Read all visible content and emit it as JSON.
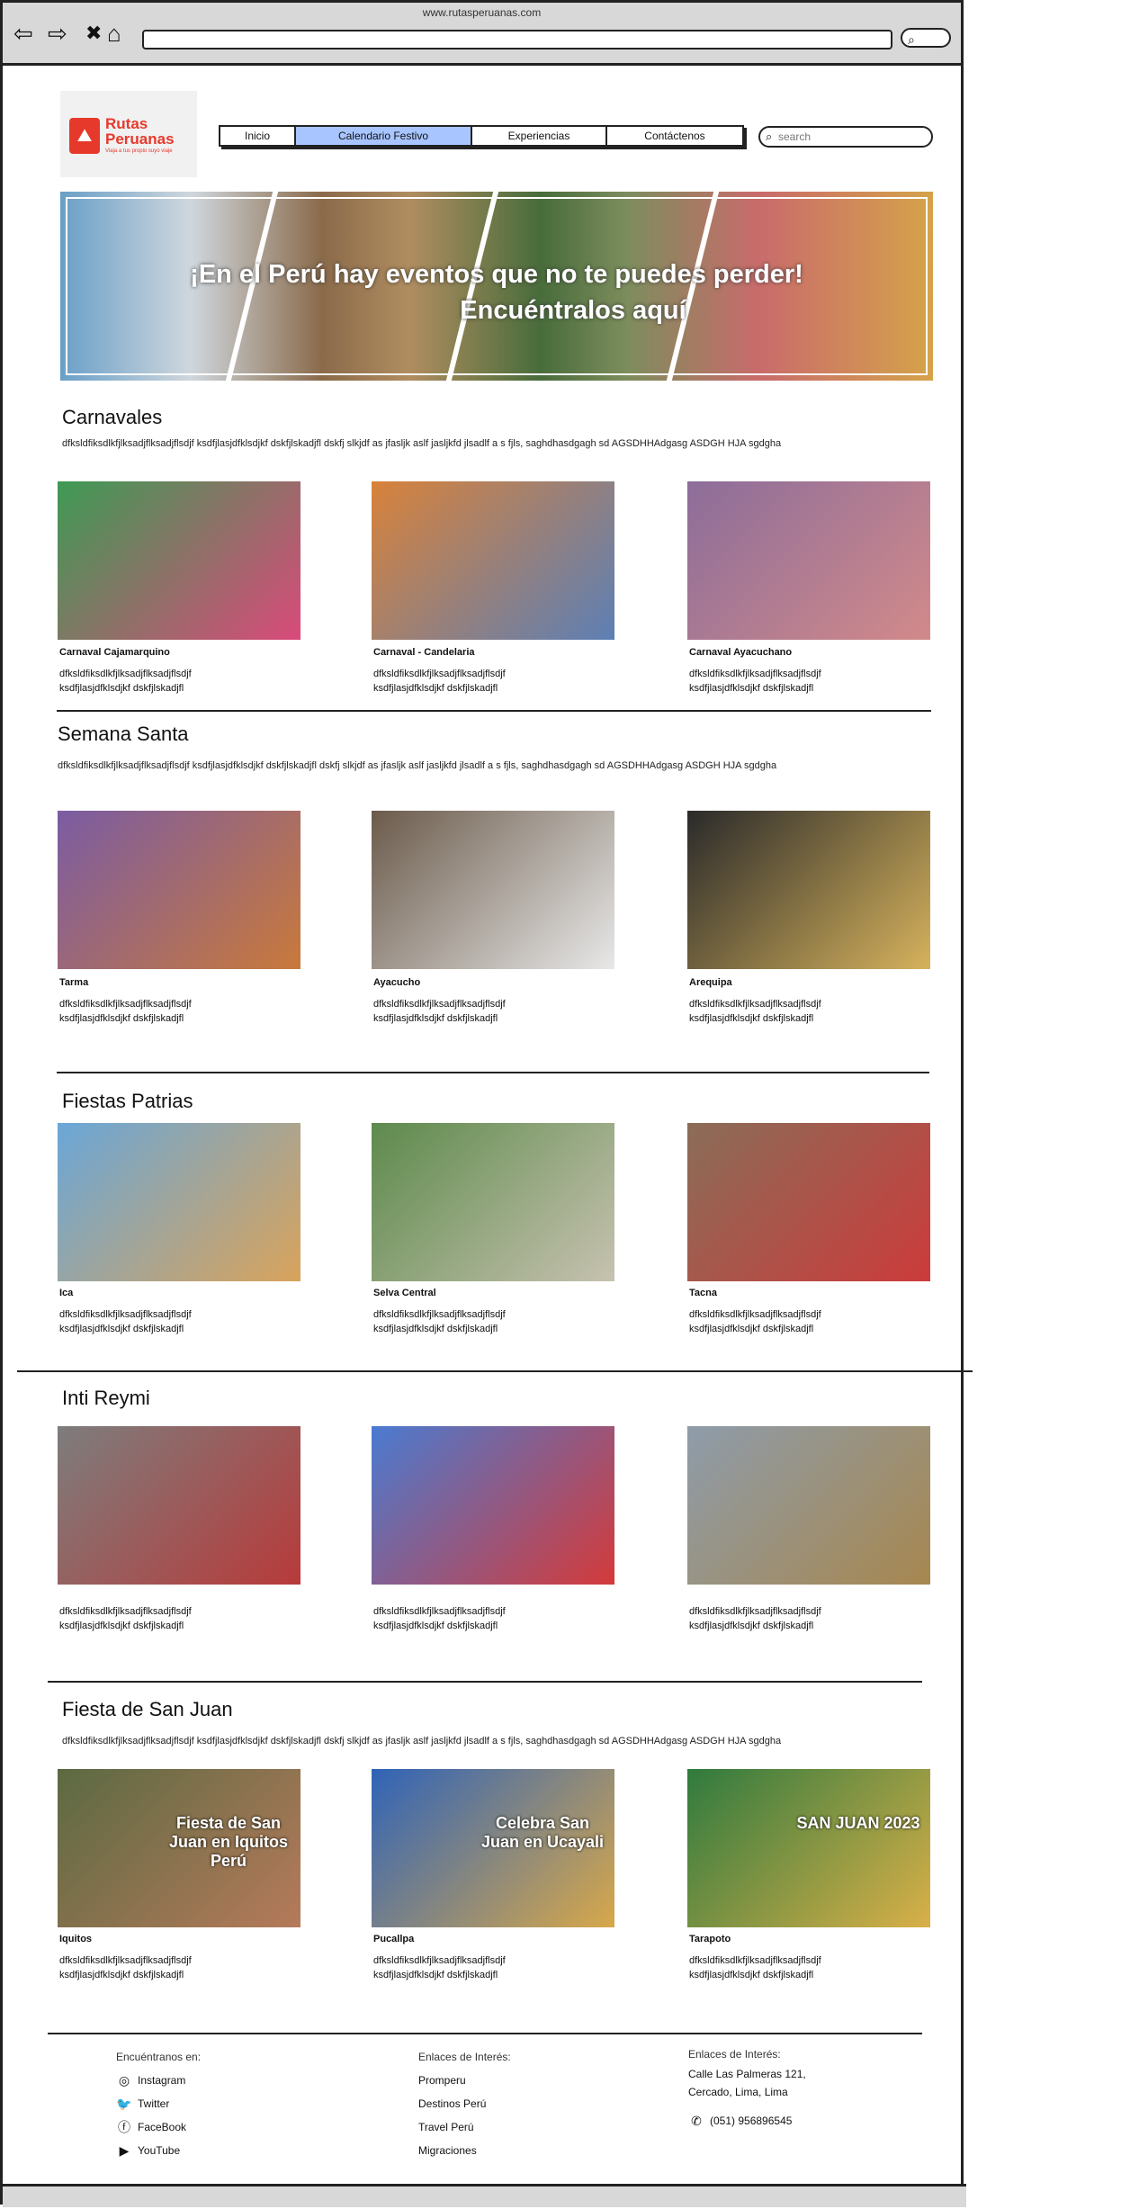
{
  "browser": {
    "url": "www.rutasperuanas.com",
    "back": "⇦",
    "forward": "⇨",
    "close": "✖",
    "home": "⌂"
  },
  "brand": {
    "title": "Rutas Peruanas",
    "tagline": "Viaja a tus propio suyo viaje"
  },
  "menu": {
    "items": [
      "Inicio",
      "Calendario Festivo",
      "Experiencias",
      "Contáctenos"
    ],
    "active": "Calendario Festivo"
  },
  "search": {
    "placeholder": "search"
  },
  "hero": {
    "line1": "¡En el Perú hay eventos que no te puedes perder!",
    "line2": "Encuéntralos aquí"
  },
  "sections": [
    {
      "title": "Carnavales",
      "desc": "dfksldfiksdlkfjlksadjflksadjflsdjf ksdfjlasjdfklsdjkf dskfjlskadjfl dskfj slkjdf as jfasljk aslf jasljkfd jlsadlf a s fjls, saghdhasdgagh sd AGSDHHAdgasg ASDGH HJA sgdgha",
      "cards": [
        {
          "name": "Carnaval Cajamarquino",
          "text": "dfksldfiksdlkfjlksadjflksadjflsdjf ksdfjlasjdfklsdjkf dskfjlskadjfl",
          "c1": "#3e9a54",
          "c2": "#d94a7a"
        },
        {
          "name": "Carnaval - Candelaria",
          "text": "dfksldfiksdlkfjlksadjflksadjflsdjf ksdfjlasjdfklsdjkf dskfjlskadjfl",
          "c1": "#d8823a",
          "c2": "#5d7fb5"
        },
        {
          "name": "Carnaval Ayacuchano",
          "text": "dfksldfiksdlkfjlksadjflksadjflsdjf ksdfjlasjdfklsdjkf dskfjlskadjfl",
          "c1": "#8c6d9a",
          "c2": "#d28a8a"
        }
      ]
    },
    {
      "title": "Semana Santa",
      "desc": "dfksldfiksdlkfjlksadjflksadjflsdjf ksdfjlasjdfklsdjkf dskfjlskadjfl dskfj slkjdf as jfasljk aslf jasljkfd jlsadlf a s fjls, saghdhasdgagh sd AGSDHHAdgasg ASDGH HJA sgdgha",
      "cards": [
        {
          "name": "Tarma",
          "text": "dfksldfiksdlkfjlksadjflksadjflsdjf ksdfjlasjdfklsdjkf dskfjlskadjfl",
          "c1": "#7b5ca3",
          "c2": "#c9793b"
        },
        {
          "name": "Ayacucho",
          "text": "dfksldfiksdlkfjlksadjflksadjflsdjf ksdfjlasjdfklsdjkf dskfjlskadjfl",
          "c1": "#6b5b4b",
          "c2": "#e8e8e8"
        },
        {
          "name": "Arequipa",
          "text": "dfksldfiksdlkfjlksadjflksadjflsdjf ksdfjlasjdfklsdjkf dskfjlskadjfl",
          "c1": "#2a2a2a",
          "c2": "#d6b25c"
        }
      ]
    },
    {
      "title": "Fiestas Patrias",
      "desc": "",
      "cards": [
        {
          "name": "Ica",
          "text": "dfksldfiksdlkfjlksadjflksadjflsdjf ksdfjlasjdfklsdjkf dskfjlskadjfl",
          "c1": "#6aa7d8",
          "c2": "#d9a35b"
        },
        {
          "name": "Selva Central",
          "text": "dfksldfiksdlkfjlksadjflksadjflsdjf ksdfjlasjdfklsdjkf dskfjlskadjfl",
          "c1": "#5d8a4c",
          "c2": "#c7c2b0"
        },
        {
          "name": "Tacna",
          "text": "dfksldfiksdlkfjlksadjflksadjflsdjf ksdfjlasjdfklsdjkf dskfjlskadjfl",
          "c1": "#8a6d58",
          "c2": "#cc3b3b"
        }
      ]
    },
    {
      "title": "Inti Reymi",
      "desc": "",
      "cards": [
        {
          "name": "",
          "text": "dfksldfiksdlkfjlksadjflksadjflsdjf ksdfjlasjdfklsdjkf dskfjlskadjfl",
          "c1": "#7d7d7d",
          "c2": "#b83a3a"
        },
        {
          "name": "",
          "text": "dfksldfiksdlkfjlksadjflksadjflsdjf ksdfjlasjdfklsdjkf dskfjlskadjfl",
          "c1": "#4a7bd1",
          "c2": "#d43a3a"
        },
        {
          "name": "",
          "text": "dfksldfiksdlkfjlksadjflksadjflsdjf ksdfjlasjdfklsdjkf dskfjlskadjfl",
          "c1": "#8e9caa",
          "c2": "#a7874f"
        }
      ]
    },
    {
      "title": "Fiesta de San Juan",
      "desc": "dfksldfiksdlkfjlksadjflksadjflsdjf ksdfjlasjdfklsdjkf dskfjlskadjfl dskfj slkjdf as jfasljk aslf jasljkfd jlsadlf a s fjls, saghdhasdgagh sd AGSDHHAdgasg ASDGH HJA sgdgha",
      "cards": [
        {
          "name": "Iquitos",
          "text": "dfksldfiksdlkfjlksadjflksadjflsdjf ksdfjlasjdfklsdjkf dskfjlskadjfl",
          "c1": "#5b6a42",
          "c2": "#b67a5a",
          "caption": "Fiesta de San Juan en Iquitos Perú"
        },
        {
          "name": "Pucallpa",
          "text": "dfksldfiksdlkfjlksadjflksadjflsdjf ksdfjlasjdfklsdjkf dskfjlskadjfl",
          "c1": "#2f63b8",
          "c2": "#d8a84a",
          "caption": "Celebra San Juan en Ucayali"
        },
        {
          "name": "Tarapoto",
          "text": "dfksldfiksdlkfjlksadjflksadjflsdjf ksdfjlasjdfklsdjkf dskfjlskadjfl",
          "c1": "#2f7a3e",
          "c2": "#d9b048",
          "caption": "SAN JUAN 2023"
        }
      ]
    }
  ],
  "footer": {
    "col1": {
      "title": "Encuéntranos en:",
      "links": [
        "Instagram",
        "Twitter",
        "FaceBook",
        "YouTube"
      ]
    },
    "col2": {
      "title": "Enlaces de Interés:",
      "links": [
        "Promperu",
        "Destinos Perú",
        "Travel Perú",
        "Migraciones"
      ]
    },
    "col3": {
      "title": "Enlaces de Interés:",
      "address1": "Calle Las Palmeras 121,",
      "address2": "Cercado, Lima, Lima",
      "phone": "(051) 956896545"
    }
  }
}
